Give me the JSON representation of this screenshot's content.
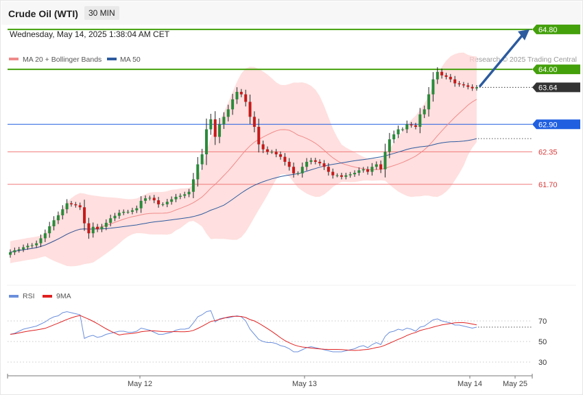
{
  "header": {
    "title": "Crude Oil (WTI)",
    "interval": "30 MIN",
    "timestamp": "Wednesday, May 14, 2025 1:38:04 AM CET"
  },
  "legend": {
    "ma20": "MA 20 + Bollinger Bands",
    "ma50": "MA 50",
    "ma20_color": "#f08a8a",
    "ma50_color": "#2c5a9e"
  },
  "copyright": "Research © 2025 Trading Central",
  "rsi_legend": {
    "rsi": "RSI",
    "ma9": "9MA",
    "rsi_color": "#6b8fdc",
    "ma9_color": "#e02020"
  },
  "colors": {
    "up_candle": "#2a8a3a",
    "down_candle": "#c41a1a",
    "resistance": "#44a00b",
    "pivot": "#1f5fe0",
    "support": "#f07878",
    "current": "#333333",
    "band_fill": "#ffd4d4",
    "arrow": "#2c5a9e"
  },
  "chart_data": [
    {
      "type": "candlestick",
      "series": [
        {
          "name": "MA 20 + Bollinger Bands"
        },
        {
          "name": "MA 50"
        }
      ],
      "x_labels": [
        "May 12",
        "May 13",
        "May 14",
        "May 25"
      ],
      "ylim": [
        60.2,
        65.3
      ],
      "close": [
        60.34,
        60.38,
        60.4,
        60.44,
        60.47,
        60.48,
        60.52,
        60.62,
        60.72,
        60.86,
        60.98,
        61.08,
        61.2,
        61.32,
        61.3,
        61.28,
        61.24,
        60.92,
        60.72,
        60.85,
        60.8,
        60.85,
        60.93,
        61.02,
        61.07,
        61.13,
        61.15,
        61.15,
        61.18,
        61.22,
        61.37,
        61.42,
        61.43,
        61.38,
        61.3,
        61.3,
        61.35,
        61.4,
        61.45,
        61.47,
        61.5,
        61.55,
        61.8,
        62.1,
        62.3,
        62.8,
        63.0,
        62.65,
        62.9,
        63.05,
        63.2,
        63.4,
        63.55,
        63.5,
        63.35,
        63.05,
        62.85,
        62.5,
        62.4,
        62.35,
        62.35,
        62.3,
        62.25,
        62.15,
        62.05,
        61.92,
        61.92,
        62.05,
        62.15,
        62.18,
        62.15,
        62.12,
        62.05,
        61.95,
        61.88,
        61.88,
        61.85,
        61.88,
        61.9,
        61.93,
        61.98,
        62.0,
        61.95,
        62.05,
        62.1,
        62.0,
        62.35,
        62.6,
        62.7,
        62.8,
        62.8,
        62.9,
        62.88,
        62.85,
        63.1,
        63.2,
        63.5,
        63.8,
        63.95,
        63.88,
        63.85,
        63.8,
        63.72,
        63.7,
        63.68,
        63.65,
        63.62,
        63.64
      ]
    },
    {
      "type": "line",
      "series": [
        {
          "name": "RSI",
          "values": [
            57,
            58,
            60,
            62,
            63,
            64,
            65,
            67,
            69,
            72,
            74,
            75,
            78,
            79,
            78,
            77,
            76,
            53,
            55,
            56,
            54,
            55,
            57,
            58,
            59,
            60,
            60,
            59,
            59,
            60,
            63,
            62,
            61,
            59,
            57,
            57,
            58,
            59,
            61,
            62,
            62,
            63,
            68,
            74,
            76,
            79,
            80,
            69,
            72,
            73,
            73,
            74,
            75,
            74,
            70,
            62,
            57,
            52,
            50,
            49,
            49,
            48,
            46,
            45,
            43,
            40,
            40,
            42,
            44,
            45,
            44,
            43,
            42,
            41,
            40,
            40,
            40,
            41,
            42,
            43,
            45,
            46,
            44,
            47,
            49,
            47,
            55,
            59,
            60,
            62,
            61,
            63,
            62,
            60,
            64,
            65,
            68,
            71,
            72,
            70,
            69,
            68,
            66,
            66,
            65,
            64,
            63,
            64
          ]
        },
        {
          "name": "9MA"
        }
      ],
      "y_ticks": [
        70,
        50,
        30
      ],
      "ylim": [
        20,
        85
      ],
      "grid": "dotted"
    }
  ],
  "levels": [
    {
      "value": 64.8,
      "label": "64.80",
      "kind": "resistance"
    },
    {
      "value": 64.0,
      "label": "64.00",
      "kind": "resistance"
    },
    {
      "value": 63.64,
      "label": "63.64",
      "kind": "current"
    },
    {
      "value": 62.9,
      "label": "62.90",
      "kind": "pivot"
    },
    {
      "value": 62.35,
      "label": "62.35",
      "kind": "support"
    },
    {
      "value": 61.7,
      "label": "61.70",
      "kind": "support"
    }
  ]
}
